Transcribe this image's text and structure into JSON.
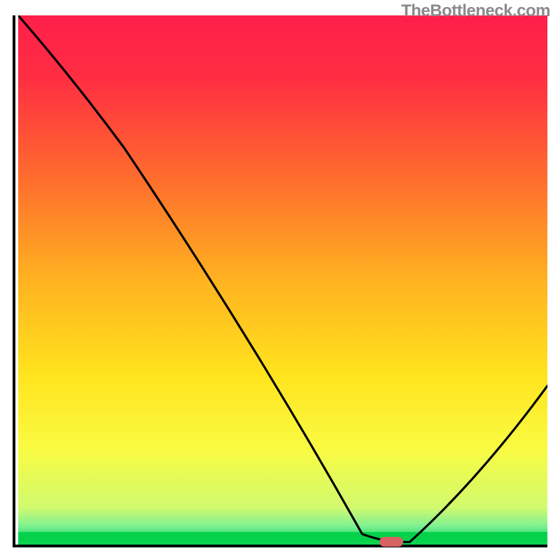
{
  "watermark": {
    "text": "TheBottleneck.com"
  },
  "chart_data": {
    "type": "line",
    "title": "",
    "xlabel": "",
    "ylabel": "",
    "xlim": [
      0,
      100
    ],
    "ylim": [
      0,
      100
    ],
    "x": [
      0,
      20,
      65,
      74,
      100
    ],
    "values": [
      100,
      75,
      2,
      0.5,
      30
    ],
    "marker": {
      "x": 71,
      "y": 0.5
    },
    "gradient_stops": [
      {
        "pos": 0.0,
        "color": "#ff1f4a"
      },
      {
        "pos": 0.12,
        "color": "#ff2e42"
      },
      {
        "pos": 0.3,
        "color": "#ff6a2e"
      },
      {
        "pos": 0.5,
        "color": "#ffb220"
      },
      {
        "pos": 0.68,
        "color": "#ffe41e"
      },
      {
        "pos": 0.82,
        "color": "#f9fb42"
      },
      {
        "pos": 0.93,
        "color": "#d1fa6e"
      },
      {
        "pos": 0.965,
        "color": "#7ff092"
      },
      {
        "pos": 0.985,
        "color": "#2cdc6e"
      },
      {
        "pos": 1.0,
        "color": "#05d24a"
      }
    ]
  },
  "colors": {
    "axis": "#000000",
    "curve": "#000000",
    "marker": "#d86262",
    "green_band": "#05d24a",
    "watermark": "#8a8a8a"
  }
}
